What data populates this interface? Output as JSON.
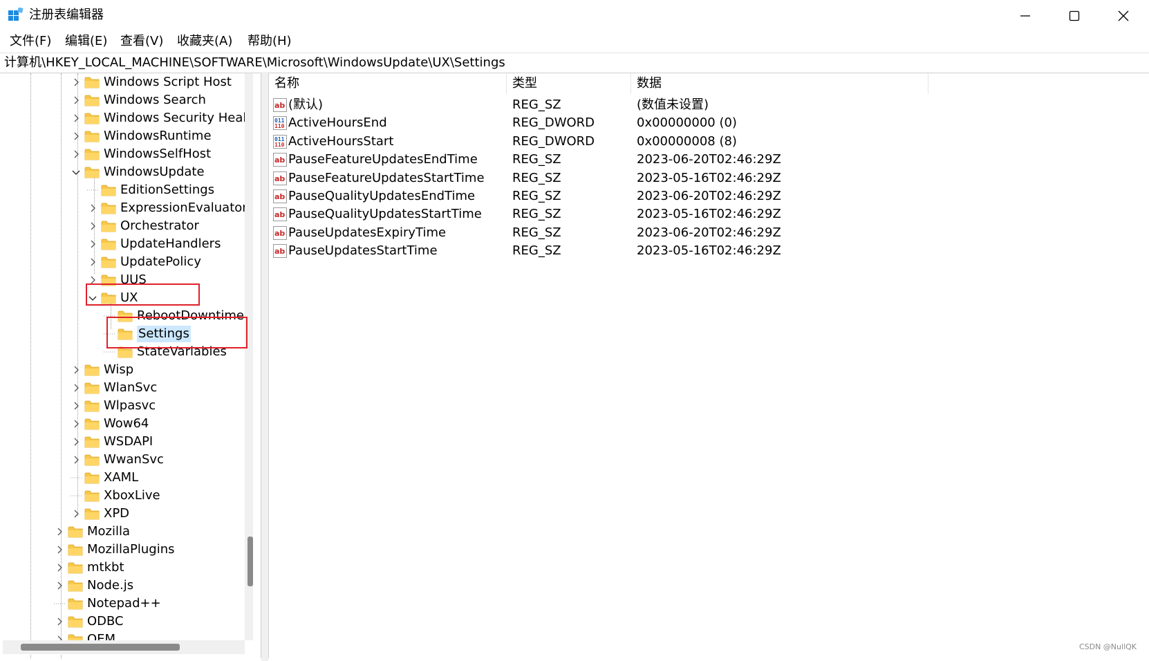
{
  "window": {
    "title": "注册表编辑器"
  },
  "menu": {
    "items": [
      {
        "label": "文件(F)"
      },
      {
        "label": "编辑(E)"
      },
      {
        "label": "查看(V)"
      },
      {
        "label": "收藏夹(A)"
      },
      {
        "label": "帮助(H)"
      }
    ]
  },
  "address": {
    "path": "计算机\\HKEY_LOCAL_MACHINE\\SOFTWARE\\Microsoft\\WindowsUpdate\\UX\\Settings"
  },
  "tree": {
    "items": [
      {
        "label": "Windows Script Host",
        "expander": "collapsed"
      },
      {
        "label": "Windows Search",
        "expander": "collapsed"
      },
      {
        "label": "Windows Security Heal",
        "expander": "collapsed"
      },
      {
        "label": "WindowsRuntime",
        "expander": "collapsed"
      },
      {
        "label": "WindowsSelfHost",
        "expander": "collapsed"
      },
      {
        "label": "WindowsUpdate",
        "expander": "expanded"
      },
      {
        "label": "EditionSettings",
        "expander": "none"
      },
      {
        "label": "ExpressionEvaluators",
        "expander": "collapsed"
      },
      {
        "label": "Orchestrator",
        "expander": "collapsed"
      },
      {
        "label": "UpdateHandlers",
        "expander": "collapsed"
      },
      {
        "label": "UpdatePolicy",
        "expander": "collapsed"
      },
      {
        "label": "UUS",
        "expander": "collapsed"
      },
      {
        "label": "UX",
        "expander": "expanded"
      },
      {
        "label": "RebootDowntime",
        "expander": "none"
      },
      {
        "label": "Settings",
        "expander": "none",
        "selected": true
      },
      {
        "label": "StateVariables",
        "expander": "none"
      },
      {
        "label": "Wisp",
        "expander": "collapsed"
      },
      {
        "label": "WlanSvc",
        "expander": "collapsed"
      },
      {
        "label": "Wlpasvc",
        "expander": "collapsed"
      },
      {
        "label": "Wow64",
        "expander": "collapsed"
      },
      {
        "label": "WSDAPI",
        "expander": "collapsed"
      },
      {
        "label": "WwanSvc",
        "expander": "collapsed"
      },
      {
        "label": "XAML",
        "expander": "none"
      },
      {
        "label": "XboxLive",
        "expander": "none"
      },
      {
        "label": "XPD",
        "expander": "collapsed"
      },
      {
        "label": "Mozilla",
        "expander": "collapsed"
      },
      {
        "label": "MozillaPlugins",
        "expander": "collapsed"
      },
      {
        "label": "mtkbt",
        "expander": "collapsed"
      },
      {
        "label": "Node.js",
        "expander": "collapsed"
      },
      {
        "label": "Notepad++",
        "expander": "none"
      },
      {
        "label": "ODBC",
        "expander": "collapsed"
      },
      {
        "label": "OEM",
        "expander": "collapsed"
      }
    ]
  },
  "list": {
    "columns": [
      "名称",
      "类型",
      "数据"
    ],
    "rows": [
      {
        "icon": "string-value-icon",
        "name": "(默认)",
        "type": "REG_SZ",
        "data": "(数值未设置)"
      },
      {
        "icon": "binary-value-icon",
        "name": "ActiveHoursEnd",
        "type": "REG_DWORD",
        "data": "0x00000000 (0)"
      },
      {
        "icon": "binary-value-icon",
        "name": "ActiveHoursStart",
        "type": "REG_DWORD",
        "data": "0x00000008 (8)"
      },
      {
        "icon": "string-value-icon",
        "name": "PauseFeatureUpdatesEndTime",
        "type": "REG_SZ",
        "data": "2023-06-20T02:46:29Z"
      },
      {
        "icon": "string-value-icon",
        "name": "PauseFeatureUpdatesStartTime",
        "type": "REG_SZ",
        "data": "2023-05-16T02:46:29Z"
      },
      {
        "icon": "string-value-icon",
        "name": "PauseQualityUpdatesEndTime",
        "type": "REG_SZ",
        "data": "2023-06-20T02:46:29Z"
      },
      {
        "icon": "string-value-icon",
        "name": "PauseQualityUpdatesStartTime",
        "type": "REG_SZ",
        "data": "2023-05-16T02:46:29Z"
      },
      {
        "icon": "string-value-icon",
        "name": "PauseUpdatesExpiryTime",
        "type": "REG_SZ",
        "data": "2023-06-20T02:46:29Z"
      },
      {
        "icon": "string-value-icon",
        "name": "PauseUpdatesStartTime",
        "type": "REG_SZ",
        "data": "2023-05-16T02:46:29Z"
      }
    ]
  },
  "watermark": "CSDN @NullQK",
  "colors": {
    "folder": "#f8c74a",
    "selection": "#cce8ff",
    "highlight_box": "#e0202a",
    "icon_blue": "#1f5fb4",
    "icon_red": "#c8282a"
  }
}
